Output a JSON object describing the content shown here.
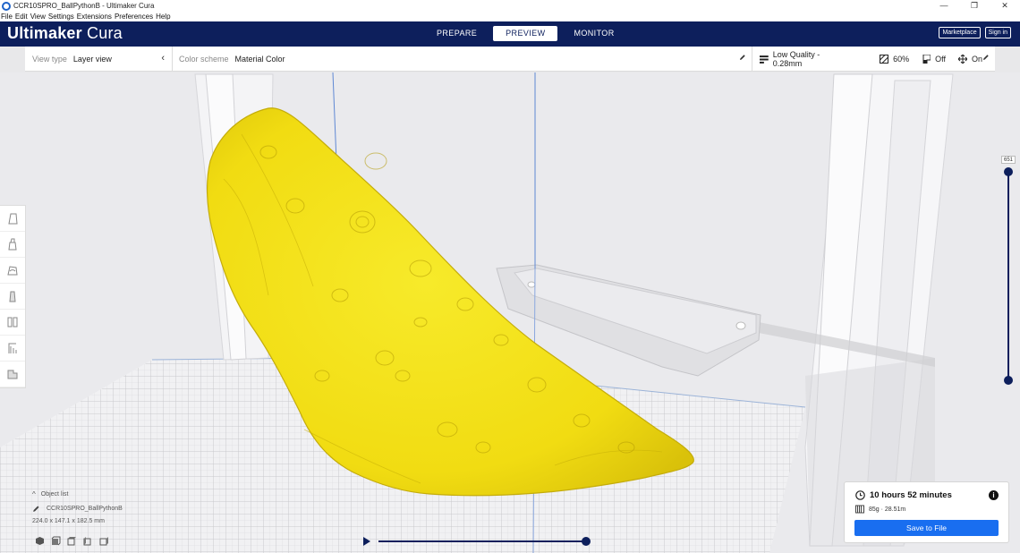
{
  "window": {
    "title": "CCR10SPRO_BallPythonB - Ultimaker Cura"
  },
  "menu": [
    "File",
    "Edit",
    "View",
    "Settings",
    "Extensions",
    "Preferences",
    "Help"
  ],
  "header": {
    "brand_bold": "Ultimaker",
    "brand_light": "Cura",
    "stages": [
      "PREPARE",
      "PREVIEW",
      "MONITOR"
    ],
    "active_stage": "PREVIEW",
    "marketplace": "Marketplace",
    "signin": "Sign in"
  },
  "toolbar": {
    "view_type_label": "View type",
    "view_type_value": "Layer view",
    "color_scheme_label": "Color scheme",
    "color_scheme_value": "Material Color",
    "quality": "Low Quality - 0.28mm",
    "infill": "60%",
    "support": "Off",
    "adhesion": "On"
  },
  "object_list": {
    "label": "Object list",
    "object_name": "CCR10SPRO_BallPythonB",
    "dimensions": "224.0 x 147.1 x 182.5 mm"
  },
  "layer_slider": {
    "value": "651"
  },
  "print": {
    "time": "10 hours 52 minutes",
    "material": "85g · 28.51m",
    "save": "Save to File"
  },
  "colors": {
    "header": "#0d1f5c",
    "accent": "#196ef0",
    "model": "#f4e41a"
  },
  "icons": [
    "app-icon",
    "chevron-left-icon",
    "pencil-icon",
    "quality-icon",
    "infill-icon",
    "support-icon",
    "adhesion-icon",
    "translate-tool-icon",
    "scale-tool-icon",
    "rotate-tool-icon",
    "mirror-tool-icon",
    "per-model-tool-icon",
    "support-blocker-icon",
    "lay-flat-icon",
    "clock-icon",
    "info-icon",
    "spool-icon",
    "play-icon"
  ]
}
